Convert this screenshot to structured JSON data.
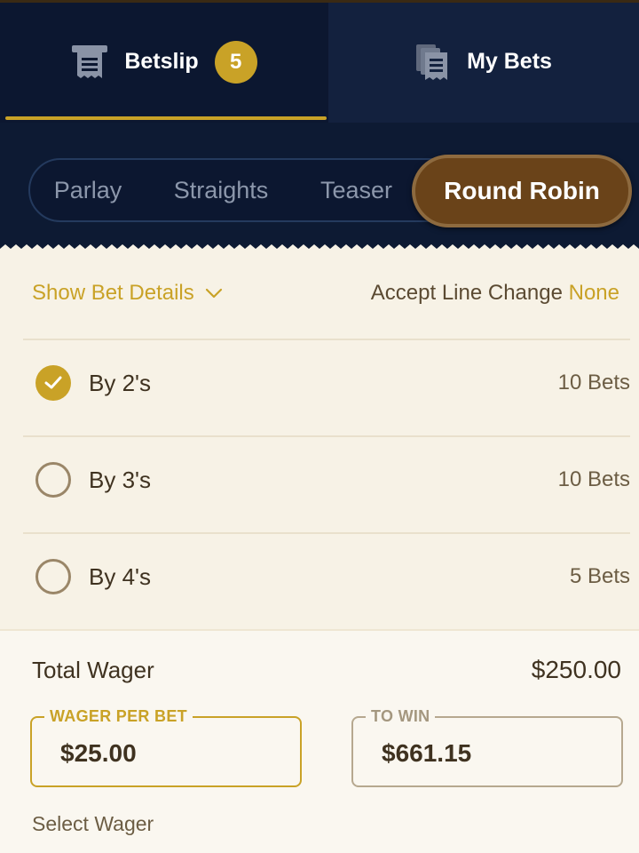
{
  "tabs": {
    "betslip": {
      "label": "Betslip",
      "badge": "5",
      "icon": "receipt-icon"
    },
    "my_bets": {
      "label": "My Bets",
      "icon": "stacked-receipts-icon"
    }
  },
  "bet_types": {
    "options": [
      "Parlay",
      "Straights",
      "Teaser",
      "Round Robin"
    ],
    "selected": "Round Robin"
  },
  "details": {
    "show_bet_details": "Show Bet Details",
    "accept_line_change_label": "Accept Line Change",
    "accept_line_change_value": "None"
  },
  "round_robin": [
    {
      "label": "By 2's",
      "count": "10 Bets",
      "checked": true
    },
    {
      "label": "By 3's",
      "count": "10 Bets",
      "checked": false
    },
    {
      "label": "By 4's",
      "count": "5 Bets",
      "checked": false
    }
  ],
  "summary": {
    "total_wager_label": "Total Wager",
    "total_wager_value": "$250.00",
    "wager_per_bet_label": "WAGER PER BET",
    "wager_per_bet_value": "$25.00",
    "to_win_label": "TO WIN",
    "to_win_value": "$661.15",
    "select_wager": "Select Wager"
  },
  "colors": {
    "gold_accent": "#c9a227",
    "active_pill": "#6a4319",
    "navy_bg": "#0d1a33",
    "panel_bg": "#f7f2e6"
  }
}
